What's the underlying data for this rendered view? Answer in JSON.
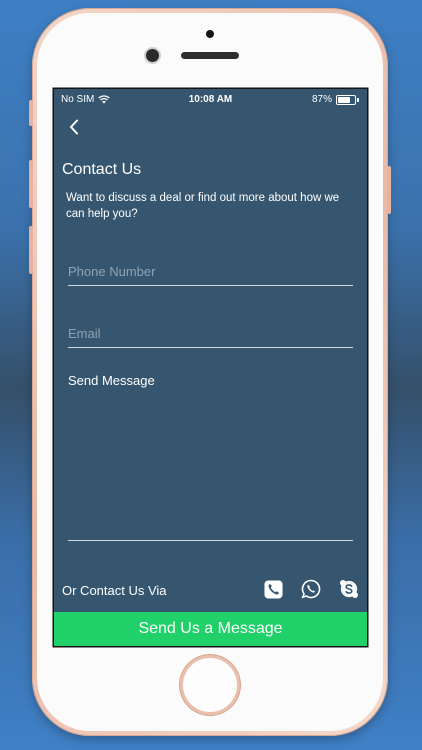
{
  "status_bar": {
    "carrier": "No SIM",
    "time": "10:08 AM",
    "battery_percent": "87%",
    "battery_level": 0.87
  },
  "page": {
    "title": "Contact Us",
    "subtitle": "Want to discuss a deal or find out more about how we can help you?"
  },
  "form": {
    "phone_placeholder": "Phone Number",
    "phone_value": "",
    "email_placeholder": "Email",
    "email_value": "",
    "message_placeholder": "Send Message",
    "message_value": ""
  },
  "contact": {
    "label": "Or Contact Us Via",
    "icons": [
      "phone-icon",
      "whatsapp-icon",
      "skype-icon"
    ]
  },
  "submit": {
    "label": "Send Us a Message"
  },
  "colors": {
    "screen_bg": "#36566f",
    "accent_green": "#1fd168"
  }
}
